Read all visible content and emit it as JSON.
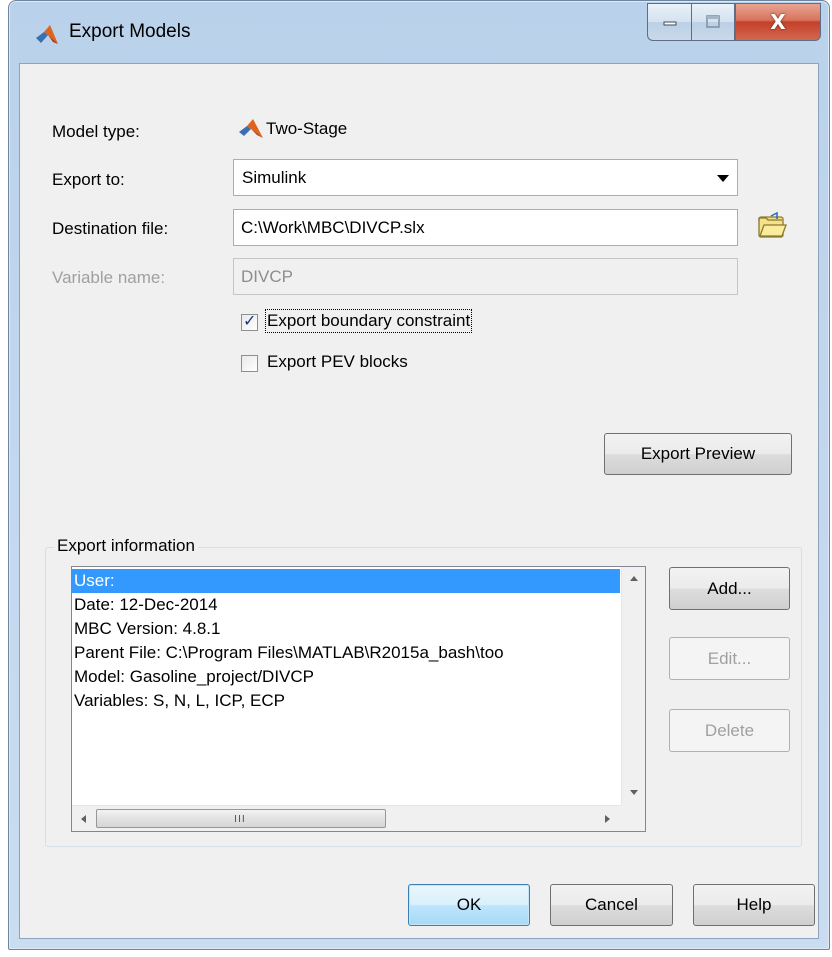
{
  "window": {
    "title": "Export Models",
    "close_glyph": "X"
  },
  "form": {
    "model_type_label": "Model type:",
    "model_type_value": "Two-Stage",
    "export_to_label": "Export to:",
    "export_to_value": "Simulink",
    "destination_label": "Destination file:",
    "destination_value": "C:\\Work\\MBC\\DIVCP.slx",
    "variable_name_label": "Variable name:",
    "variable_name_value": "DIVCP",
    "export_boundary_label": "Export boundary constraint",
    "export_boundary_checked": true,
    "export_pev_label": "Export PEV blocks",
    "export_pev_checked": false,
    "export_preview_label": "Export Preview"
  },
  "export_info": {
    "group_title": "Export information",
    "items": [
      "User:",
      "Date: 12-Dec-2014",
      "MBC Version: 4.8.1",
      "Parent File: C:\\Program Files\\MATLAB\\R2015a_bash\\too",
      "Model: Gasoline_project/DIVCP",
      "Variables: S, N, L, ICP, ECP"
    ],
    "selected_index": 0,
    "scroll_grip": "III",
    "add_label": "Add...",
    "edit_label": "Edit...",
    "delete_label": "Delete"
  },
  "footer": {
    "ok_label": "OK",
    "cancel_label": "Cancel",
    "help_label": "Help"
  },
  "icons": {
    "title_icon": "matlab-logo-icon",
    "model_icon": "matlab-logo-icon",
    "folder_icon": "open-folder-icon"
  },
  "colors": {
    "selection": "#3399ff",
    "default_button": "#bee6fd",
    "close_button": "#c4402a"
  }
}
